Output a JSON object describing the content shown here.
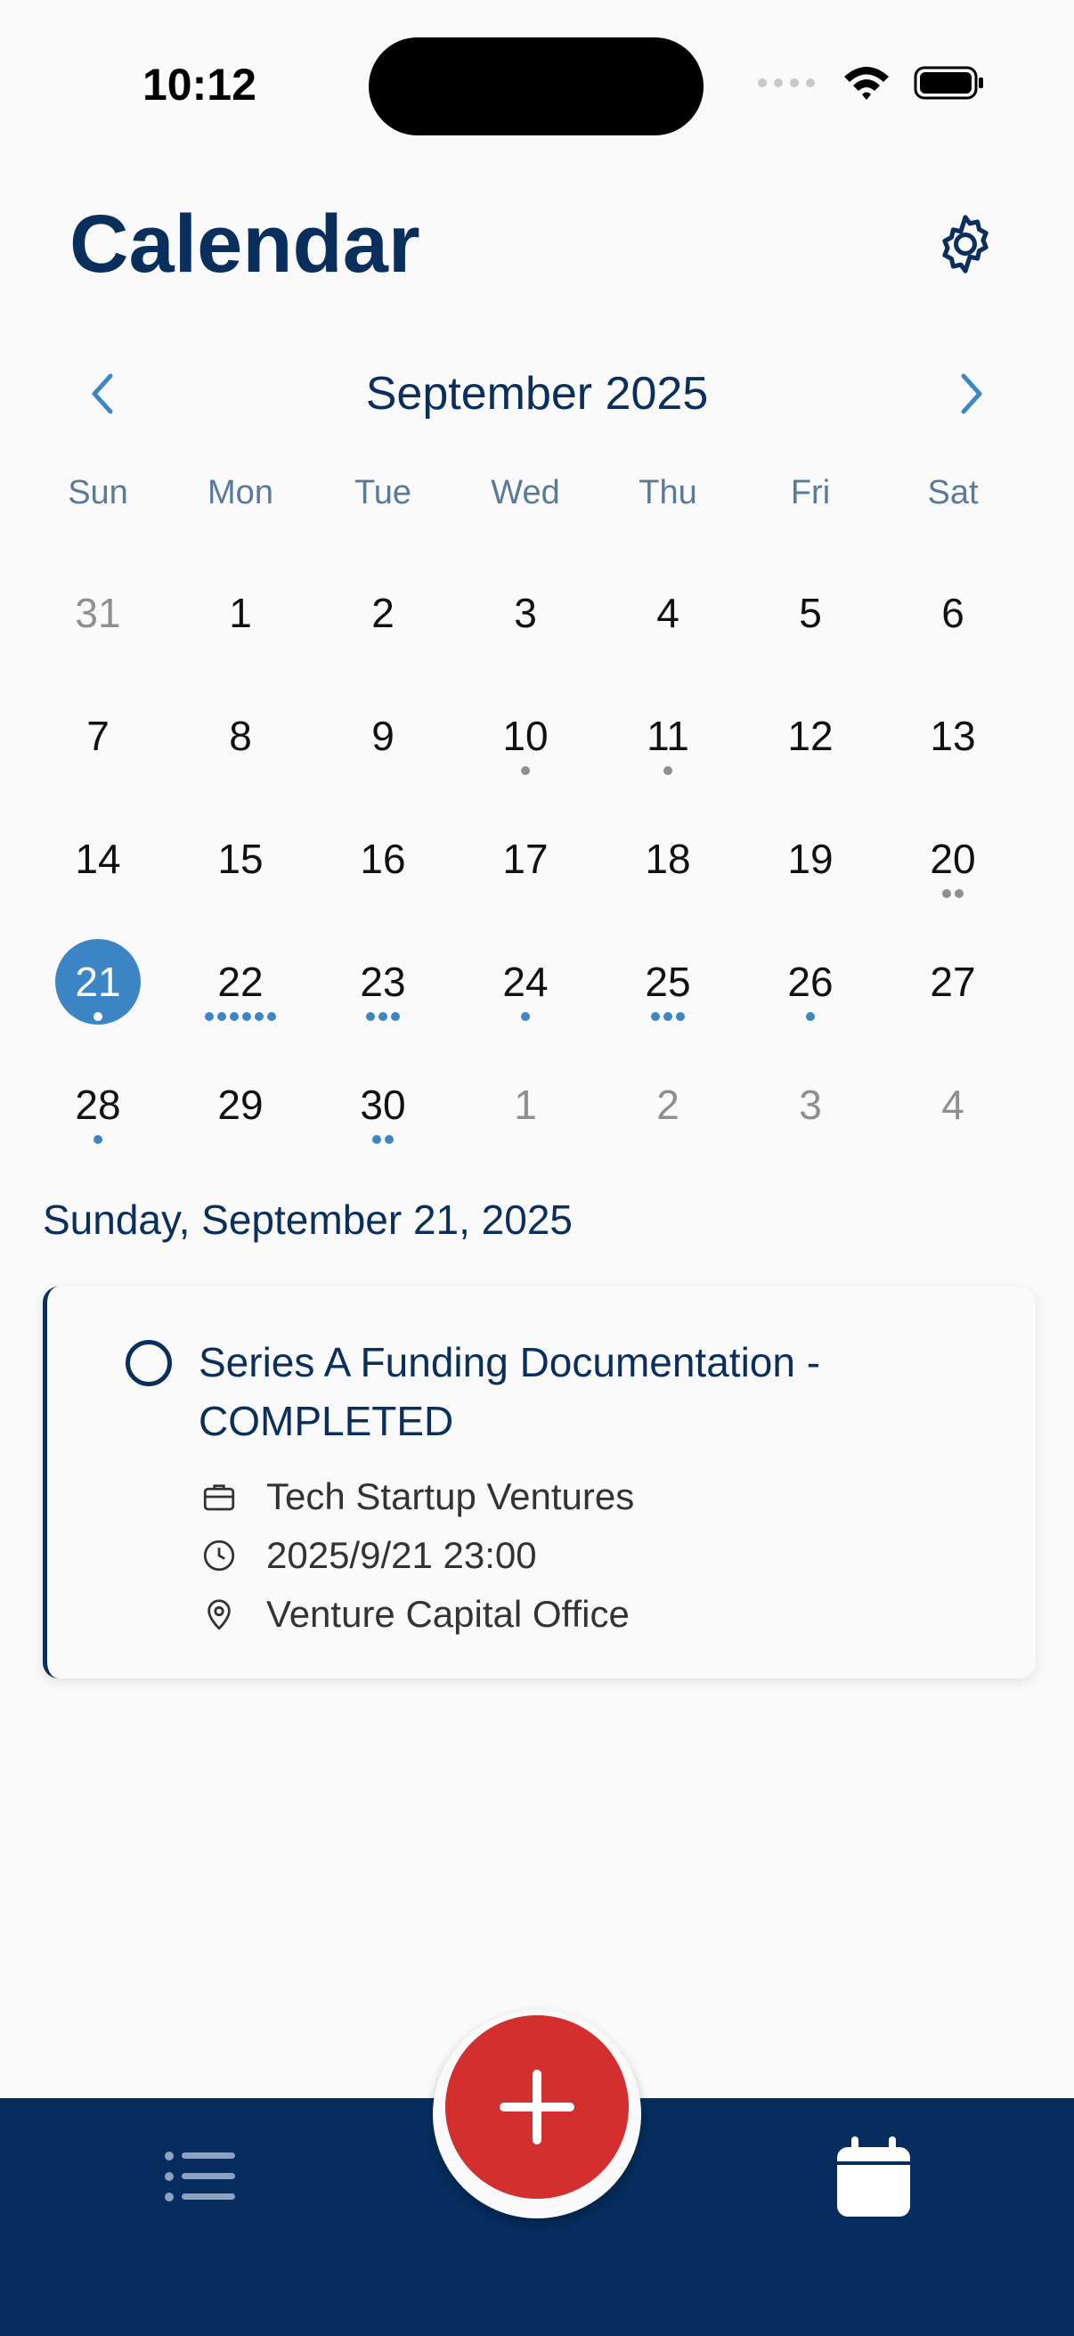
{
  "status_bar": {
    "time": "10:12",
    "icons": [
      "cellular-dots-icon",
      "wifi-icon",
      "battery-icon"
    ]
  },
  "header": {
    "title": "Calendar",
    "settings_icon": "gear-icon"
  },
  "calendar": {
    "month_label": "September 2025",
    "prev_icon": "chevron-left-icon",
    "next_icon": "chevron-right-icon",
    "weekdays": [
      "Sun",
      "Mon",
      "Tue",
      "Wed",
      "Thu",
      "Fri",
      "Sat"
    ],
    "days": [
      {
        "label": "31",
        "other": true,
        "dots": 0
      },
      {
        "label": "1",
        "dots": 0
      },
      {
        "label": "2",
        "dots": 0
      },
      {
        "label": "3",
        "dots": 0
      },
      {
        "label": "4",
        "dots": 0
      },
      {
        "label": "5",
        "dots": 0
      },
      {
        "label": "6",
        "dots": 0
      },
      {
        "label": "7",
        "dots": 0
      },
      {
        "label": "8",
        "dots": 0
      },
      {
        "label": "9",
        "dots": 0
      },
      {
        "label": "10",
        "dots": 1,
        "dot_color": "grey"
      },
      {
        "label": "11",
        "dots": 1,
        "dot_color": "grey"
      },
      {
        "label": "12",
        "dots": 0
      },
      {
        "label": "13",
        "dots": 0
      },
      {
        "label": "14",
        "dots": 0
      },
      {
        "label": "15",
        "dots": 0
      },
      {
        "label": "16",
        "dots": 0
      },
      {
        "label": "17",
        "dots": 0
      },
      {
        "label": "18",
        "dots": 0
      },
      {
        "label": "19",
        "dots": 0
      },
      {
        "label": "20",
        "dots": 2,
        "dot_color": "grey"
      },
      {
        "label": "21",
        "dots": 1,
        "selected": true
      },
      {
        "label": "22",
        "dots": 6
      },
      {
        "label": "23",
        "dots": 3
      },
      {
        "label": "24",
        "dots": 1
      },
      {
        "label": "25",
        "dots": 3
      },
      {
        "label": "26",
        "dots": 1
      },
      {
        "label": "27",
        "dots": 0
      },
      {
        "label": "28",
        "dots": 1
      },
      {
        "label": "29",
        "dots": 0
      },
      {
        "label": "30",
        "dots": 2
      },
      {
        "label": "1",
        "other": true,
        "dots": 0
      },
      {
        "label": "2",
        "other": true,
        "dots": 0
      },
      {
        "label": "3",
        "other": true,
        "dots": 0
      },
      {
        "label": "4",
        "other": true,
        "dots": 0
      }
    ]
  },
  "selected_date_heading": "Sunday, September 21, 2025",
  "task": {
    "title": "Series A Funding Documentation - COMPLETED",
    "company": "Tech Startup Ventures",
    "datetime": "2025/9/21 23:00",
    "location": "Venture Capital Office",
    "icons": [
      "briefcase-icon",
      "clock-icon",
      "map-pin-icon"
    ]
  },
  "tab_bar": {
    "left_icon": "list-icon",
    "center_icon": "plus-icon",
    "right_icon": "calendar-icon"
  },
  "colors": {
    "navy": "#0a2f5c",
    "accent_blue": "#3d86c6",
    "fab_red": "#d32f2f",
    "tab_bar": "#062d5e",
    "muted_grey": "#8e8e93"
  }
}
